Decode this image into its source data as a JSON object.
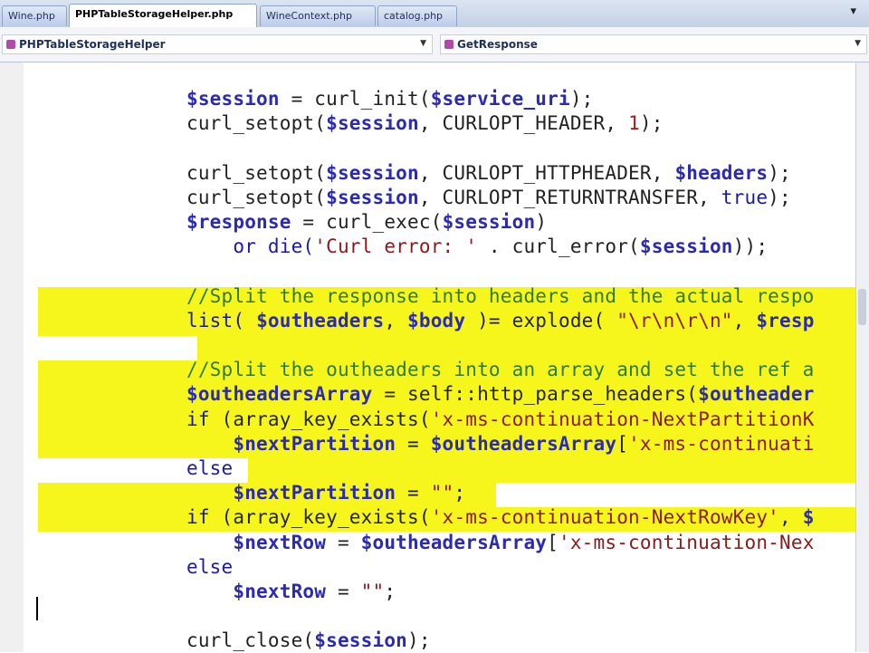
{
  "tabs": [
    {
      "label": "Wine.php",
      "active": false
    },
    {
      "label": "PHPTableStorageHelper.php",
      "active": true
    },
    {
      "label": "WineContext.php",
      "active": false
    },
    {
      "label": "catalog.php",
      "active": false
    }
  ],
  "tab_overflow_icon": "chevron-down-icon",
  "class_dropdown": {
    "value": "PHPTableStorageHelper"
  },
  "member_dropdown": {
    "value": "GetResponse"
  },
  "colors": {
    "highlight": "#f6f61c",
    "variable": "#2a2ab3",
    "comment": "#2f7a2f",
    "string": "#8b1a1a"
  },
  "code_lines": [
    [
      {
        "t": "$session",
        "c": "var"
      },
      {
        "t": " = ",
        "c": "fn"
      },
      {
        "t": "curl_init(",
        "c": "fn"
      },
      {
        "t": "$service_uri",
        "c": "var"
      },
      {
        "t": ");",
        "c": "fn"
      }
    ],
    [
      {
        "t": "curl_setopt(",
        "c": "fn"
      },
      {
        "t": "$session",
        "c": "var"
      },
      {
        "t": ", CURLOPT_HEADER, ",
        "c": "cst"
      },
      {
        "t": "1",
        "c": "num"
      },
      {
        "t": ");",
        "c": "fn"
      }
    ],
    [],
    [
      {
        "t": "curl_setopt(",
        "c": "fn"
      },
      {
        "t": "$session",
        "c": "var"
      },
      {
        "t": ", CURLOPT_HTTPHEADER, ",
        "c": "cst"
      },
      {
        "t": "$headers",
        "c": "var"
      },
      {
        "t": ");",
        "c": "fn"
      }
    ],
    [
      {
        "t": "curl_setopt(",
        "c": "fn"
      },
      {
        "t": "$session",
        "c": "var"
      },
      {
        "t": ", CURLOPT_RETURNTRANSFER, ",
        "c": "cst"
      },
      {
        "t": "true",
        "c": "kw"
      },
      {
        "t": ");",
        "c": "fn"
      }
    ],
    [
      {
        "t": "$response",
        "c": "var"
      },
      {
        "t": " = curl_exec(",
        "c": "fn"
      },
      {
        "t": "$session",
        "c": "var"
      },
      {
        "t": ")",
        "c": "fn"
      }
    ],
    [
      {
        "t": "    or ",
        "c": "kw"
      },
      {
        "t": "die(",
        "c": "kw"
      },
      {
        "t": "'Curl error: '",
        "c": "str"
      },
      {
        "t": " . curl_error(",
        "c": "fn"
      },
      {
        "t": "$session",
        "c": "var"
      },
      {
        "t": "));",
        "c": "fn"
      }
    ],
    [],
    [
      {
        "t": "//Split the response into headers and the actual respo",
        "c": "cmt"
      }
    ],
    [
      {
        "t": "list( ",
        "c": "kw"
      },
      {
        "t": "$outheaders",
        "c": "var"
      },
      {
        "t": ", ",
        "c": "fn"
      },
      {
        "t": "$body",
        "c": "var"
      },
      {
        "t": " )= explode( ",
        "c": "fn"
      },
      {
        "t": "\"\\r\\n\\r\\n\"",
        "c": "str"
      },
      {
        "t": ", ",
        "c": "fn"
      },
      {
        "t": "$resp",
        "c": "var"
      }
    ],
    [],
    [
      {
        "t": "//Split the outheaders into an array and set the ref a",
        "c": "cmt"
      }
    ],
    [
      {
        "t": "$outheadersArray",
        "c": "var"
      },
      {
        "t": " = self::http_parse_headers(",
        "c": "fn"
      },
      {
        "t": "$outheader",
        "c": "var"
      }
    ],
    [
      {
        "t": "if ",
        "c": "kw"
      },
      {
        "t": "(array_key_exists(",
        "c": "fn"
      },
      {
        "t": "'x-ms-continuation-NextPartitionK",
        "c": "str"
      }
    ],
    [
      {
        "t": "    ",
        "c": "fn"
      },
      {
        "t": "$nextPartition",
        "c": "var"
      },
      {
        "t": " = ",
        "c": "fn"
      },
      {
        "t": "$outheadersArray",
        "c": "var"
      },
      {
        "t": "[",
        "c": "fn"
      },
      {
        "t": "'x-ms-continuati",
        "c": "str"
      }
    ],
    [
      {
        "t": "else",
        "c": "kw"
      }
    ],
    [
      {
        "t": "    ",
        "c": "fn"
      },
      {
        "t": "$nextPartition",
        "c": "var"
      },
      {
        "t": " = ",
        "c": "fn"
      },
      {
        "t": "\"\"",
        "c": "str"
      },
      {
        "t": ";",
        "c": "fn"
      }
    ],
    [
      {
        "t": "if ",
        "c": "kw"
      },
      {
        "t": "(array_key_exists(",
        "c": "fn"
      },
      {
        "t": "'x-ms-continuation-NextRowKey'",
        "c": "str"
      },
      {
        "t": ", ",
        "c": "fn"
      },
      {
        "t": "$",
        "c": "var"
      }
    ],
    [
      {
        "t": "    ",
        "c": "fn"
      },
      {
        "t": "$nextRow",
        "c": "var"
      },
      {
        "t": " = ",
        "c": "fn"
      },
      {
        "t": "$outheadersArray",
        "c": "var"
      },
      {
        "t": "[",
        "c": "fn"
      },
      {
        "t": "'x-ms-continuation-Nex",
        "c": "str"
      }
    ],
    [
      {
        "t": "else",
        "c": "kw"
      }
    ],
    [
      {
        "t": "    ",
        "c": "fn"
      },
      {
        "t": "$nextRow",
        "c": "var"
      },
      {
        "t": " = ",
        "c": "fn"
      },
      {
        "t": "\"\"",
        "c": "str"
      },
      {
        "t": ";",
        "c": "fn"
      }
    ],
    [],
    [
      {
        "t": "curl_close(",
        "c": "fn"
      },
      {
        "t": "$session",
        "c": "var"
      },
      {
        "t": ");",
        "c": "fn"
      }
    ]
  ]
}
